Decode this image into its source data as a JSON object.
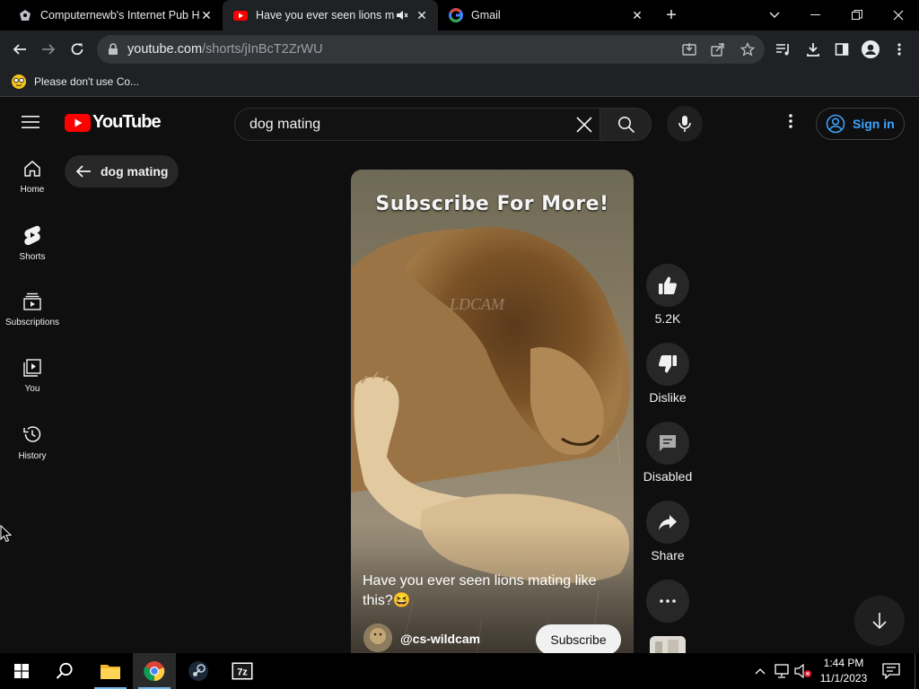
{
  "browser": {
    "tabs": [
      {
        "title": "Computernewb's Internet Pub H",
        "active": false
      },
      {
        "title": "Have you ever seen lions ma",
        "active": true
      },
      {
        "title": "Gmail",
        "active": false
      }
    ],
    "url_host": "youtube.com",
    "url_path": "/shorts/jInBcT2ZrWU",
    "bookmark": "Please don't use Co..."
  },
  "youtube": {
    "logo_text": "YouTube",
    "search_value": "dog mating",
    "sign_in": "Sign in",
    "chip": "dog mating",
    "guide": [
      {
        "label": "Home",
        "icon": "home-icon"
      },
      {
        "label": "Shorts",
        "icon": "shorts-icon"
      },
      {
        "label": "Subscriptions",
        "icon": "subscriptions-icon"
      },
      {
        "label": "You",
        "icon": "you-icon"
      },
      {
        "label": "History",
        "icon": "history-icon"
      }
    ],
    "short": {
      "overlay_text": "Subscribe For More!",
      "watermark": "LDCAM",
      "caption": "Have you ever seen lions mating like this?😆",
      "channel": "@cs-wildcam",
      "subscribe": "Subscribe"
    },
    "actions": {
      "like_count": "5.2K",
      "dislike": "Dislike",
      "comments": "Disabled",
      "share": "Share"
    }
  },
  "taskbar": {
    "time": "1:44 PM",
    "date": "11/1/2023"
  }
}
